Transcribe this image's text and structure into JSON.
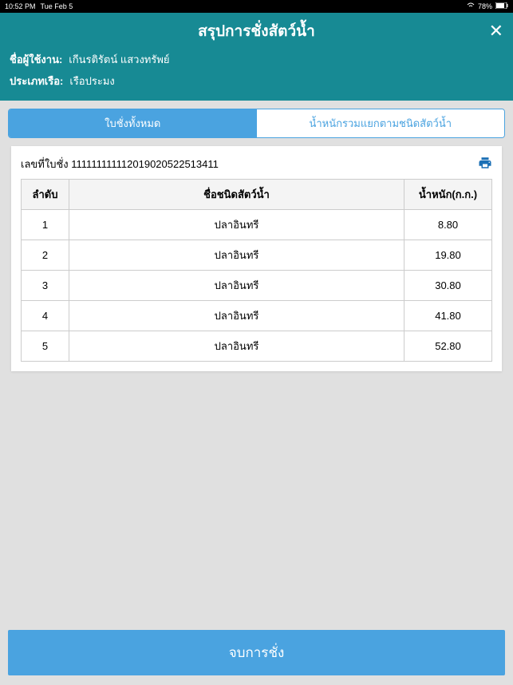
{
  "statusBar": {
    "time": "10:52 PM",
    "date": "Tue Feb 5",
    "battery": "78%"
  },
  "header": {
    "title": "สรุปการชั่งสัตว์น้ำ",
    "userLabel": "ชื่อผู้ใช้งาน:",
    "userName": "เกีนรติรัตน์ แสวงทรัพย์",
    "boatTypeLabel": "ประเภทเรือ:",
    "boatType": "เรือประมง"
  },
  "tabs": {
    "tab1": "ใบชั่งทั้งหมด",
    "tab2": "น้ำหนักรวมแยกตามชนิดสัตว์น้ำ"
  },
  "card": {
    "receiptLabel": "เลขที่ใบชั่ง",
    "receiptNumber": "111111111112019020522513411"
  },
  "table": {
    "headers": {
      "seq": "ลำดับ",
      "species": "ชื่อชนิดสัตว์น้ำ",
      "weight": "น้ำหนัก(ก.ก.)"
    },
    "rows": [
      {
        "seq": "1",
        "species": "ปลาอินทรี",
        "weight": "8.80"
      },
      {
        "seq": "2",
        "species": "ปลาอินทรี",
        "weight": "19.80"
      },
      {
        "seq": "3",
        "species": "ปลาอินทรี",
        "weight": "30.80"
      },
      {
        "seq": "4",
        "species": "ปลาอินทรี",
        "weight": "41.80"
      },
      {
        "seq": "5",
        "species": "ปลาอินทรี",
        "weight": "52.80"
      }
    ]
  },
  "finishButton": "จบการชั่ง"
}
